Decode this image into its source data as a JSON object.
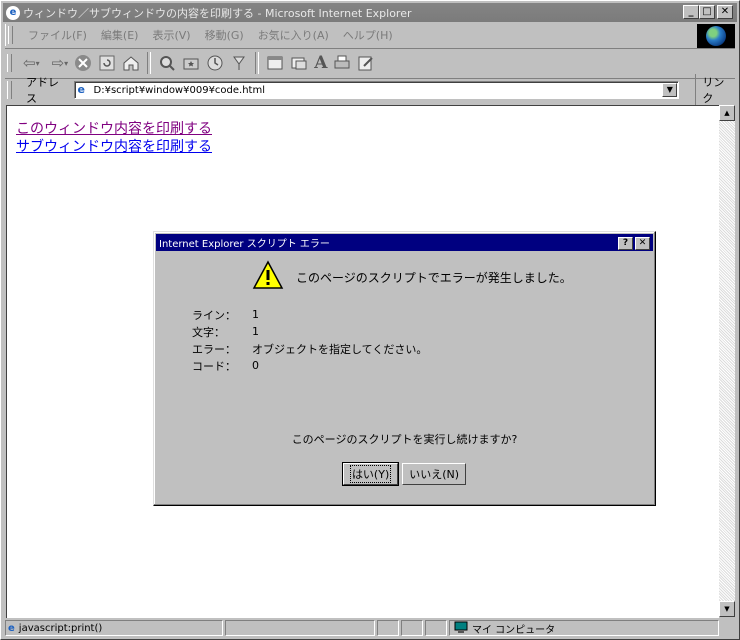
{
  "window": {
    "title": "ウィンドウ／サブウィンドウの内容を印刷する - Microsoft Internet Explorer",
    "buttons": {
      "minimize": "_",
      "maximize": "□",
      "close": "✕"
    }
  },
  "menubar": {
    "items": [
      {
        "label": "ファイル(F)"
      },
      {
        "label": "編集(E)"
      },
      {
        "label": "表示(V)"
      },
      {
        "label": "移動(G)"
      },
      {
        "label": "お気に入り(A)"
      },
      {
        "label": "ヘルプ(H)"
      }
    ]
  },
  "toolbar": {
    "icons": [
      "back-icon",
      "forward-icon",
      "stop-icon",
      "refresh-icon",
      "home-icon",
      "search-icon",
      "favorites-icon",
      "history-icon",
      "channels-icon",
      "fullscreen-icon",
      "mail-icon",
      "font-icon",
      "print-icon",
      "edit-icon"
    ]
  },
  "address": {
    "label": "アドレス",
    "value": "D:¥script¥window¥009¥code.html",
    "links_label": "リンク"
  },
  "page": {
    "links": [
      {
        "text": "このウィンドウ内容を印刷する",
        "state": "visited"
      },
      {
        "text": "サブウィンドウ内容を印刷する",
        "state": "unvisited"
      }
    ]
  },
  "dialog": {
    "title": "Internet Explorer スクリプト エラー",
    "message": "このページのスクリプトでエラーが発生しました。",
    "details": [
      {
        "label": "ライン：",
        "value": "1"
      },
      {
        "label": "文字：",
        "value": "1"
      },
      {
        "label": "エラー：",
        "value": "オブジェクトを指定してください。"
      },
      {
        "label": "コード：",
        "value": "0"
      }
    ],
    "question": "このページのスクリプトを実行し続けますか?",
    "yes_label": "はい(Y)",
    "no_label": "いいえ(N)",
    "help_btn": "?",
    "close_btn": "✕"
  },
  "statusbar": {
    "text": "javascript:print()",
    "zone": "マイ コンピュータ"
  },
  "colors": {
    "titlebar_inactive": "#848484",
    "dialog_title": "#000080",
    "link_visited": "#800080",
    "link_unvisited": "#0000ee",
    "face": "#c0c0c0"
  }
}
